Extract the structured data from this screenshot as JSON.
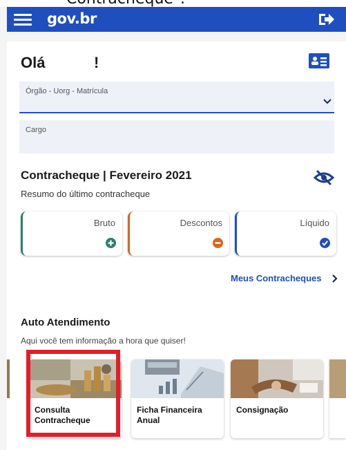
{
  "top_text": "Contracheque\".",
  "header": {
    "logo": "gov.br",
    "menu_icon": "hamburger-icon",
    "logout_icon": "logout-icon"
  },
  "profile": {
    "greeting": "Olá",
    "exclaim": "!",
    "card_icon": "id-card-icon"
  },
  "fields": {
    "orgao_label": "Órgão - Uorg - Matrícula",
    "cargo_label": "Cargo"
  },
  "paycheck": {
    "title": "Contracheque | Fevereiro 2021",
    "subtitle": "Resumo do último contracheque",
    "visibility_icon": "eye-off-icon",
    "boxes": [
      {
        "label": "Bruto",
        "icon": "plus-icon",
        "color": "#2e7d6b"
      },
      {
        "label": "Descontos",
        "icon": "minus-icon",
        "color": "#d9651c"
      },
      {
        "label": "Líquido",
        "icon": "check-icon",
        "color": "#1f4fbf"
      }
    ],
    "link": "Meus Contracheques"
  },
  "auto": {
    "title": "Auto Atendimento",
    "subtitle": "Aqui você tem informação a hora que quiser!",
    "services": [
      {
        "line1": "Consulta",
        "line2": "Contracheque"
      },
      {
        "line1": "Ficha Financeira",
        "line2": "Anual"
      },
      {
        "line1": "Consignação",
        "line2": ""
      }
    ]
  },
  "colors": {
    "header": "#1f4fbf",
    "highlight": "#e31e2b"
  }
}
